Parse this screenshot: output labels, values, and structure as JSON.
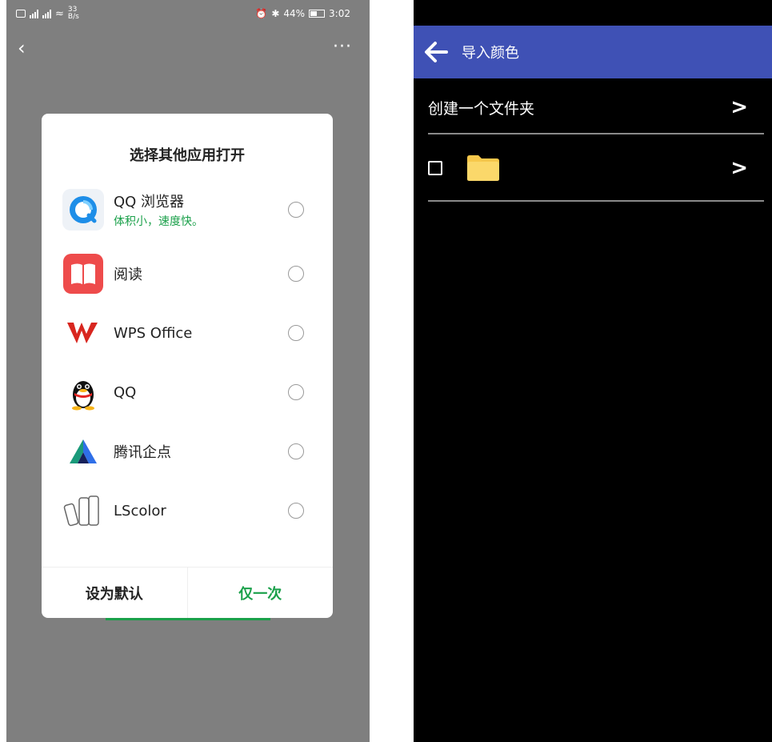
{
  "left_screen": {
    "status_bar": {
      "left_text": "33",
      "left_unit": "B/s",
      "right_text": "44%",
      "time": "3:02"
    },
    "nav": {
      "back_glyph": "‹",
      "more_glyph": "···"
    },
    "dialog": {
      "title": "选择其他应用打开",
      "apps": [
        {
          "name": "QQ 浏览器",
          "subtitle": "体积小，速度快。",
          "icon": "qq-browser-icon"
        },
        {
          "name": "阅读",
          "subtitle": "",
          "icon": "reader-icon"
        },
        {
          "name": "WPS Office",
          "subtitle": "",
          "icon": "wps-icon"
        },
        {
          "name": "QQ",
          "subtitle": "",
          "icon": "qq-penguin-icon"
        },
        {
          "name": "腾讯企点",
          "subtitle": "",
          "icon": "tencent-qidian-icon"
        },
        {
          "name": "LScolor",
          "subtitle": "",
          "icon": "lscolor-icon"
        }
      ],
      "buttons": {
        "set_default": "设为默认",
        "just_once": "仅一次"
      }
    },
    "colors": {
      "accent_green": "#1aa04a",
      "overlay": "#7f7f7f"
    }
  },
  "right_screen": {
    "app_bar": {
      "title": "导入颜色",
      "back_icon": "arrow-left-icon"
    },
    "rows": [
      {
        "label": "创建一个文件夹",
        "chevron": ">"
      },
      {
        "label": "",
        "chevron": ">"
      }
    ],
    "colors": {
      "app_bar": "#3f51b5",
      "background": "#000000",
      "folder": "#f7c84b"
    }
  }
}
